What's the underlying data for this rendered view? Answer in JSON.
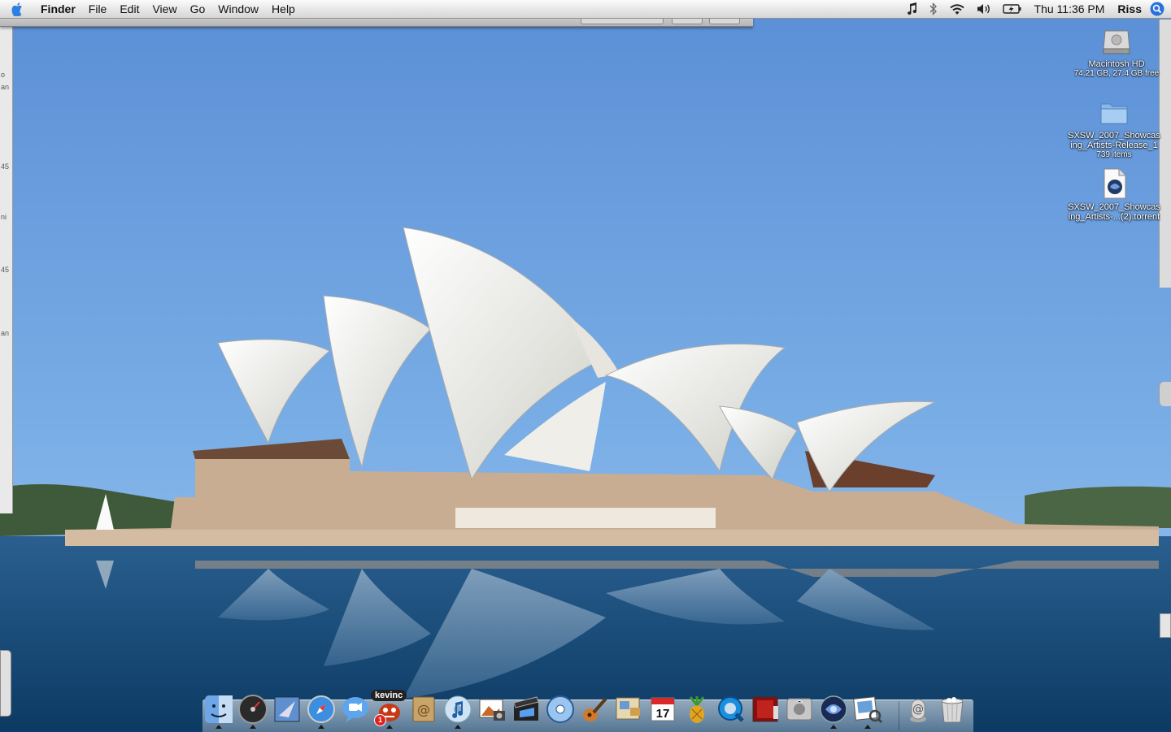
{
  "menubar": {
    "app_name": "Finder",
    "menus": [
      "File",
      "Edit",
      "View",
      "Go",
      "Window",
      "Help"
    ],
    "clock": "Thu 11:36 PM",
    "user": "Riss",
    "status_icons": [
      "itunes-note-icon",
      "bluetooth-icon",
      "wifi-icon",
      "volume-icon",
      "battery-icon"
    ]
  },
  "desktop": {
    "icons": [
      {
        "name": "Macintosh HD",
        "sub": "74.21 GB, 27.4 GB free",
        "icon": "hard-drive-icon"
      },
      {
        "name": "SXSW_2007_Showcasing_Artists-Release_1",
        "sub": "739 items",
        "icon": "folder-icon"
      },
      {
        "name": "SXSW_2007_Showcasing_Artists-...(2).torrent",
        "sub": "",
        "icon": "torrent-file-icon"
      }
    ]
  },
  "dock": {
    "adium_label": "kevinc",
    "adium_badge": "1",
    "items": [
      {
        "name": "Finder",
        "icon": "finder-icon",
        "running": true
      },
      {
        "name": "Dashboard",
        "icon": "dashboard-icon",
        "running": true
      },
      {
        "name": "Mail",
        "icon": "mail-icon",
        "running": false
      },
      {
        "name": "Safari",
        "icon": "safari-icon",
        "running": true
      },
      {
        "name": "iChat",
        "icon": "ichat-icon",
        "running": false
      },
      {
        "name": "Adium",
        "icon": "adium-icon",
        "running": true
      },
      {
        "name": "Address Book",
        "icon": "address-book-icon",
        "running": false
      },
      {
        "name": "iTunes",
        "icon": "itunes-icon",
        "running": true
      },
      {
        "name": "iPhoto",
        "icon": "iphoto-icon",
        "running": false
      },
      {
        "name": "iMovie",
        "icon": "imovie-icon",
        "running": false
      },
      {
        "name": "iDVD",
        "icon": "idvd-icon",
        "running": false
      },
      {
        "name": "GarageBand",
        "icon": "garageband-icon",
        "running": false
      },
      {
        "name": "Preview",
        "icon": "preview-icon",
        "running": false
      },
      {
        "name": "iCal",
        "icon": "ical-icon",
        "running": false
      },
      {
        "name": "Adium Duck",
        "icon": "fruit-icon",
        "running": false
      },
      {
        "name": "QuickTime",
        "icon": "quicktime-icon",
        "running": false
      },
      {
        "name": "Photo Booth",
        "icon": "photobooth-icon",
        "running": false
      },
      {
        "name": "System Preferences",
        "icon": "system-prefs-icon",
        "running": false
      },
      {
        "name": "Torrent",
        "icon": "torrent-app-icon",
        "running": true
      },
      {
        "name": "Preview Image",
        "icon": "preview-image-icon",
        "running": true
      },
      {
        "name": "Mail Downloads",
        "icon": "downloads-stack-icon",
        "running": false
      },
      {
        "name": "Trash",
        "icon": "trash-icon",
        "running": false
      }
    ],
    "calendar_day": "17"
  }
}
